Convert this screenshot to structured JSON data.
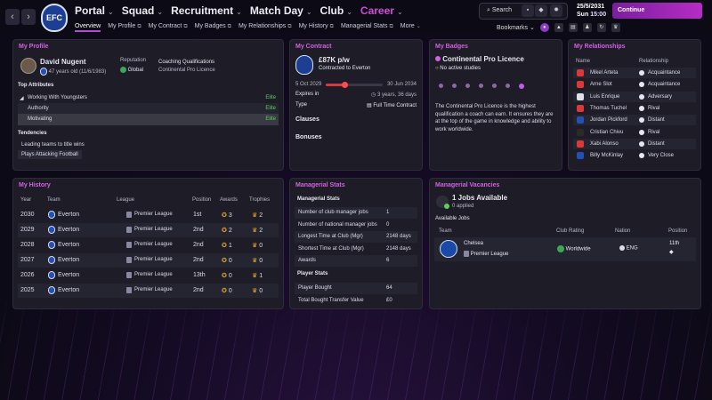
{
  "nav": {
    "back": "‹",
    "forward": "›",
    "items": [
      "Portal",
      "Squad",
      "Recruitment",
      "Match Day",
      "Club",
      "Career"
    ],
    "sub": [
      "Overview",
      "My Profile",
      "My Contract",
      "My Badges",
      "My Relationships",
      "My History",
      "Managerial Stats",
      "More"
    ],
    "search_label": "Search",
    "date": "25/5/2031",
    "day": "Sun",
    "time": "15:00",
    "continue_label": "Continue",
    "bookmarks_label": "Bookmarks"
  },
  "colors": {
    "accent": "#d062e0",
    "continue": "#b62cc4",
    "positive": "#58d05c"
  },
  "club": {
    "crest_text": "EFC"
  },
  "profile": {
    "title": "My Profile",
    "name": "David Nugent",
    "age": "47 years old (11/6/1983)",
    "reputation_label": "Reputation",
    "reputation_value": "Global",
    "coaching_label": "Coaching Qualifications",
    "coaching_value": "Continental Pro Licence",
    "attributes_title": "Top Attributes",
    "attributes": [
      {
        "name": "Working With Youngsters",
        "value": "Elite"
      },
      {
        "name": "Authority",
        "value": "Elite"
      },
      {
        "name": "Motivating",
        "value": "Elite"
      }
    ],
    "tendencies_title": "Tendencies",
    "tendencies": [
      "Leading teams to title wins",
      "Plays Attacking Football"
    ]
  },
  "contract": {
    "title": "My Contract",
    "wage": "£87K p/w",
    "club_text": "Contracted to Everton",
    "start": "5 Oct 2029",
    "end": "30 Jun 2034",
    "progress": 0.32,
    "expires_label": "Expires in",
    "expires_value": "3 years, 36 days",
    "type_label": "Type",
    "type_value": "Full Time Contract",
    "clauses": "Clauses",
    "bonuses": "Bonuses"
  },
  "badges": {
    "title": "My Badges",
    "name": "Continental Pro Licence",
    "sub": "No active studies",
    "description": "The Continental Pro Licence is the highest qualification a coach can earn. It ensures they are at the top of the game in knowledge and ability to work worldwide."
  },
  "relationships": {
    "title": "My Relationships",
    "col_name": "Name",
    "col_rel": "Relationship",
    "rows": [
      {
        "name": "Mikel Arteta",
        "rel": "Acquaintance"
      },
      {
        "name": "Arne Slot",
        "rel": "Acquaintance"
      },
      {
        "name": "Luis Enrique",
        "rel": "Adversary"
      },
      {
        "name": "Thomas Tuchel",
        "rel": "Rival"
      },
      {
        "name": "Jordan Pickford",
        "rel": "Distant"
      },
      {
        "name": "Cristian Chivu",
        "rel": "Rival"
      },
      {
        "name": "Xabi Alonso",
        "rel": "Distant"
      },
      {
        "name": "Billy McKinlay",
        "rel": "Very Close"
      }
    ]
  },
  "history": {
    "title": "My History",
    "cols": [
      "Year",
      "Team",
      "League",
      "Position",
      "Awards",
      "Trophies"
    ],
    "rows": [
      {
        "year": "2030",
        "team": "Everton",
        "league": "Premier League",
        "pos": "1st",
        "awards": "3",
        "trophies": "2"
      },
      {
        "year": "2029",
        "team": "Everton",
        "league": "Premier League",
        "pos": "2nd",
        "awards": "2",
        "trophies": "2"
      },
      {
        "year": "2028",
        "team": "Everton",
        "league": "Premier League",
        "pos": "2nd",
        "awards": "1",
        "trophies": "0"
      },
      {
        "year": "2027",
        "team": "Everton",
        "league": "Premier League",
        "pos": "2nd",
        "awards": "0",
        "trophies": "0"
      },
      {
        "year": "2026",
        "team": "Everton",
        "league": "Premier League",
        "pos": "13th",
        "awards": "0",
        "trophies": "1"
      },
      {
        "year": "2025",
        "team": "Everton",
        "league": "Premier League",
        "pos": "2nd",
        "awards": "0",
        "trophies": "0"
      }
    ]
  },
  "stats": {
    "title": "Managerial Stats",
    "section1": "Managerial Stats",
    "rows1": [
      {
        "label": "Number of club manager jobs",
        "value": "1"
      },
      {
        "label": "Number of national manager jobs",
        "value": "0"
      },
      {
        "label": "Longest Time at Club (Mgr)",
        "value": "2148 days"
      },
      {
        "label": "Shortest Time at Club (Mgr)",
        "value": "2148 days"
      },
      {
        "label": "Awards",
        "value": "6"
      }
    ],
    "section2": "Player Stats",
    "rows2": [
      {
        "label": "Player Bought",
        "value": "64"
      },
      {
        "label": "Total Bought Transfer Value",
        "value": "£0"
      }
    ]
  },
  "vacancies": {
    "title": "Managerial Vacancies",
    "jobs": "1 Jobs Available",
    "applied": "0 applied",
    "available_label": "Available Jobs",
    "cols": [
      "Team",
      "Club Rating",
      "Nation",
      "Position"
    ],
    "job": {
      "team": "Chelsea",
      "league": "Premier League",
      "rating": "Worldwide",
      "nation": "ENG",
      "position": "11th"
    }
  }
}
